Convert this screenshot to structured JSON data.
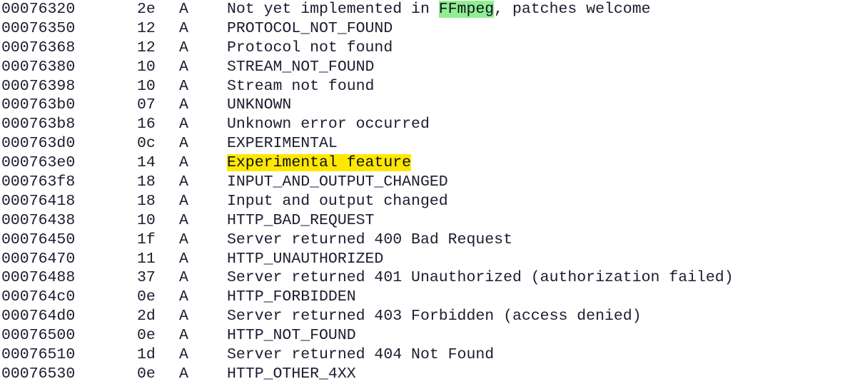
{
  "view": {
    "name": "strings-dump",
    "background_color": "#ffffff",
    "text_color": "#1c1c30",
    "columns": [
      "address",
      "length",
      "type",
      "string"
    ],
    "highlight_colors": {
      "green": "#90ee90",
      "yellow": "#ffe800"
    }
  },
  "rows": [
    {
      "address": "00076320",
      "length": "2e",
      "type": "A",
      "segments": [
        {
          "text": "Not yet implemented in ",
          "highlight": "none"
        },
        {
          "text": "FFmpeg",
          "highlight": "green"
        },
        {
          "text": ", patches welcome",
          "highlight": "none"
        }
      ]
    },
    {
      "address": "00076350",
      "length": "12",
      "type": "A",
      "segments": [
        {
          "text": "PROTOCOL_NOT_FOUND",
          "highlight": "none"
        }
      ]
    },
    {
      "address": "00076368",
      "length": "12",
      "type": "A",
      "segments": [
        {
          "text": "Protocol not found",
          "highlight": "none"
        }
      ]
    },
    {
      "address": "00076380",
      "length": "10",
      "type": "A",
      "segments": [
        {
          "text": "STREAM_NOT_FOUND",
          "highlight": "none"
        }
      ]
    },
    {
      "address": "00076398",
      "length": "10",
      "type": "A",
      "segments": [
        {
          "text": "Stream not found",
          "highlight": "none"
        }
      ]
    },
    {
      "address": "000763b0",
      "length": "07",
      "type": "A",
      "segments": [
        {
          "text": "UNKNOWN",
          "highlight": "none"
        }
      ]
    },
    {
      "address": "000763b8",
      "length": "16",
      "type": "A",
      "segments": [
        {
          "text": "Unknown error occurred",
          "highlight": "none"
        }
      ]
    },
    {
      "address": "000763d0",
      "length": "0c",
      "type": "A",
      "segments": [
        {
          "text": "EXPERIMENTAL",
          "highlight": "none"
        }
      ]
    },
    {
      "address": "000763e0",
      "length": "14",
      "type": "A",
      "segments": [
        {
          "text": "Experimental feature",
          "highlight": "yellow"
        }
      ]
    },
    {
      "address": "000763f8",
      "length": "18",
      "type": "A",
      "segments": [
        {
          "text": "INPUT_AND_OUTPUT_CHANGED",
          "highlight": "none"
        }
      ]
    },
    {
      "address": "00076418",
      "length": "18",
      "type": "A",
      "segments": [
        {
          "text": "Input and output changed",
          "highlight": "none"
        }
      ]
    },
    {
      "address": "00076438",
      "length": "10",
      "type": "A",
      "segments": [
        {
          "text": "HTTP_BAD_REQUEST",
          "highlight": "none"
        }
      ]
    },
    {
      "address": "00076450",
      "length": "1f",
      "type": "A",
      "segments": [
        {
          "text": "Server returned 400 Bad Request",
          "highlight": "none"
        }
      ]
    },
    {
      "address": "00076470",
      "length": "11",
      "type": "A",
      "segments": [
        {
          "text": "HTTP_UNAUTHORIZED",
          "highlight": "none"
        }
      ]
    },
    {
      "address": "00076488",
      "length": "37",
      "type": "A",
      "segments": [
        {
          "text": "Server returned 401 Unauthorized (authorization failed)",
          "highlight": "none"
        }
      ]
    },
    {
      "address": "000764c0",
      "length": "0e",
      "type": "A",
      "segments": [
        {
          "text": "HTTP_FORBIDDEN",
          "highlight": "none"
        }
      ]
    },
    {
      "address": "000764d0",
      "length": "2d",
      "type": "A",
      "segments": [
        {
          "text": "Server returned 403 Forbidden (access denied)",
          "highlight": "none"
        }
      ]
    },
    {
      "address": "00076500",
      "length": "0e",
      "type": "A",
      "segments": [
        {
          "text": "HTTP_NOT_FOUND",
          "highlight": "none"
        }
      ]
    },
    {
      "address": "00076510",
      "length": "1d",
      "type": "A",
      "segments": [
        {
          "text": "Server returned 404 Not Found",
          "highlight": "none"
        }
      ]
    },
    {
      "address": "00076530",
      "length": "0e",
      "type": "A",
      "segments": [
        {
          "text": "HTTP_OTHER_4XX",
          "highlight": "none"
        }
      ]
    }
  ]
}
